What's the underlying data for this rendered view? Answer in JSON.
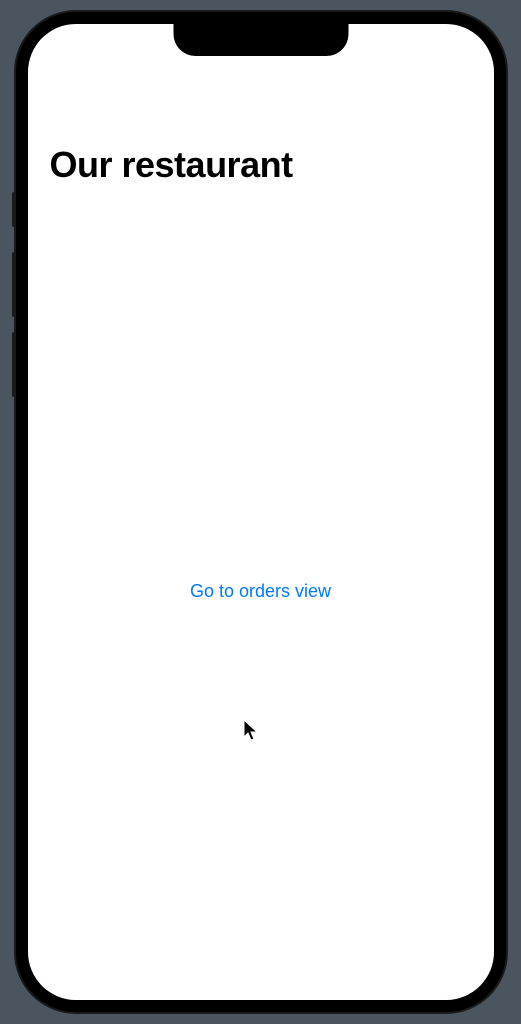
{
  "header": {
    "title": "Our restaurant"
  },
  "main": {
    "link_label": "Go to orders view"
  },
  "colors": {
    "link": "#007AFF",
    "background": "#ffffff",
    "text": "#000000"
  }
}
